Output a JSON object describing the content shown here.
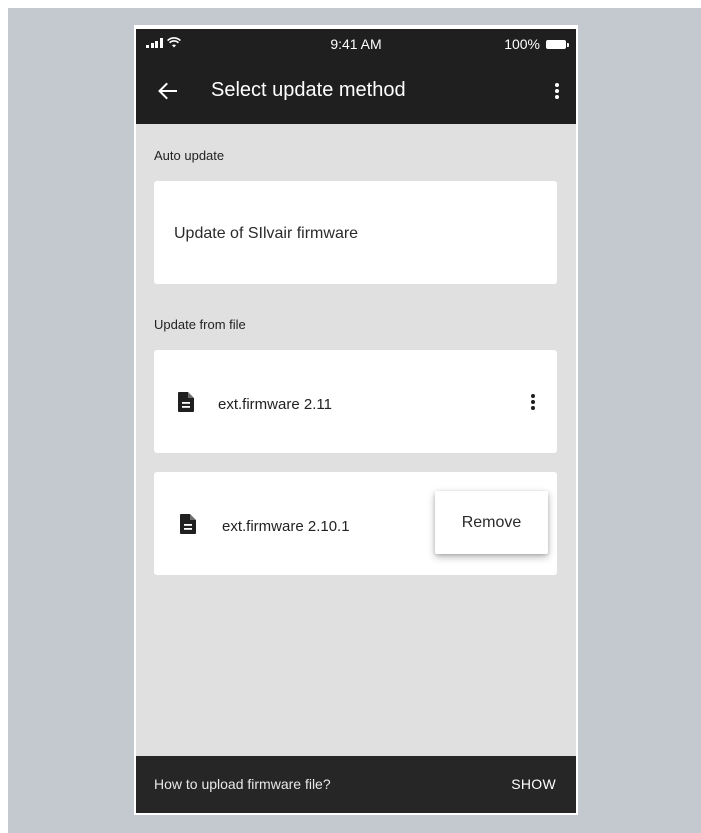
{
  "status_bar": {
    "time": "9:41 AM",
    "battery": "100%",
    "icons": [
      "signal-icon",
      "wifi-icon",
      "battery-icon"
    ]
  },
  "app_bar": {
    "title": "Select update method",
    "back_icon": "arrow-back-icon",
    "more_icon": "more-vert-icon"
  },
  "auto_update": {
    "header": "Auto update",
    "item_label": "Update of SIlvair firmware"
  },
  "from_file": {
    "header": "Update from file",
    "files": [
      {
        "name": "ext.firmware 2.11",
        "icon": "file-icon"
      },
      {
        "name": "ext.firmware 2.10.1",
        "icon": "file-icon"
      }
    ]
  },
  "popup_menu": {
    "items": [
      "Remove"
    ]
  },
  "snackbar": {
    "text": "How to upload firmware file?",
    "action": "SHOW"
  },
  "colors": {
    "app_bar_bg": "#1f1f1f",
    "screen_bg": "#e0e0e0",
    "backdrop": "#c4c8cf",
    "card_bg": "#ffffff",
    "snackbar_bg": "#262626"
  }
}
